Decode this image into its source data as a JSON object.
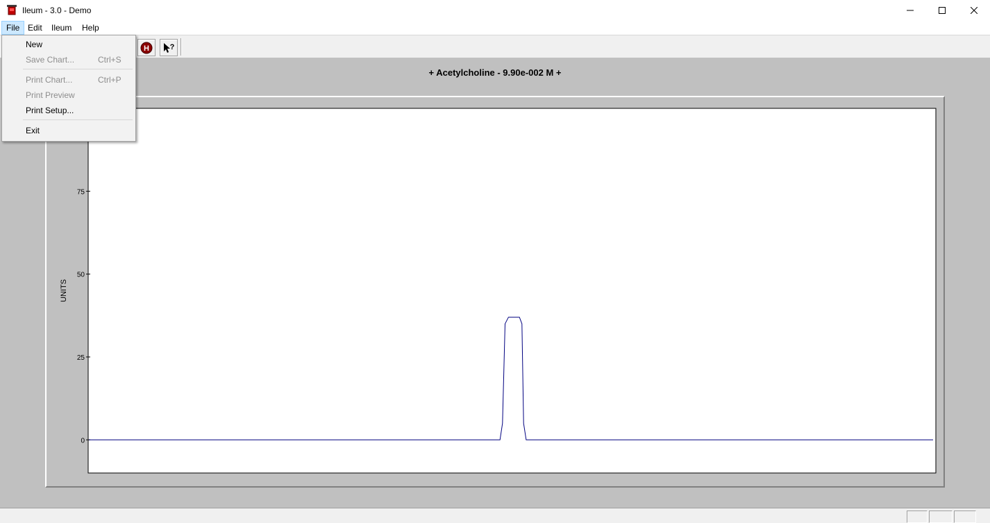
{
  "window": {
    "title": "Ileum - 3.0 - Demo"
  },
  "menubar": {
    "items": [
      {
        "label": "File"
      },
      {
        "label": "Edit"
      },
      {
        "label": "Ileum"
      },
      {
        "label": "Help"
      }
    ]
  },
  "file_menu": {
    "items": [
      {
        "label": "New",
        "shortcut": "",
        "enabled": true
      },
      {
        "label": "Save Chart...",
        "shortcut": "Ctrl+S",
        "enabled": false
      },
      {
        "label": "Print Chart...",
        "shortcut": "Ctrl+P",
        "enabled": false
      },
      {
        "label": "Print Preview",
        "shortcut": "",
        "enabled": false
      },
      {
        "label": "Print Setup...",
        "shortcut": "",
        "enabled": true
      },
      {
        "label": "Exit",
        "shortcut": "",
        "enabled": true
      }
    ]
  },
  "toolbar": {
    "icons": [
      "h-help-icon",
      "context-help-pointer-icon"
    ]
  },
  "chart": {
    "title": "+ Acetylcholine - 9.90e-002 M +"
  },
  "chart_data": {
    "type": "line",
    "title": "+ Acetylcholine - 9.90e-002 M +",
    "xlabel": "",
    "ylabel": "UNITS",
    "yticks": [
      0,
      25,
      50,
      75
    ],
    "ylim": [
      -10,
      100
    ],
    "xlim": [
      0,
      1000
    ],
    "grid": false,
    "series": [
      {
        "color": "#000080",
        "x": [
          0,
          487,
          490,
          493,
          497,
          504,
          510,
          513,
          515,
          518,
          1000
        ],
        "y": [
          0,
          0,
          5,
          35,
          37,
          37,
          37,
          35,
          5,
          0,
          0
        ]
      }
    ]
  },
  "colors": {
    "workspace": "#c0c0c0",
    "plot_bg": "#ffffff",
    "trace": "#000080",
    "menu_highlight": "#cce8ff"
  }
}
